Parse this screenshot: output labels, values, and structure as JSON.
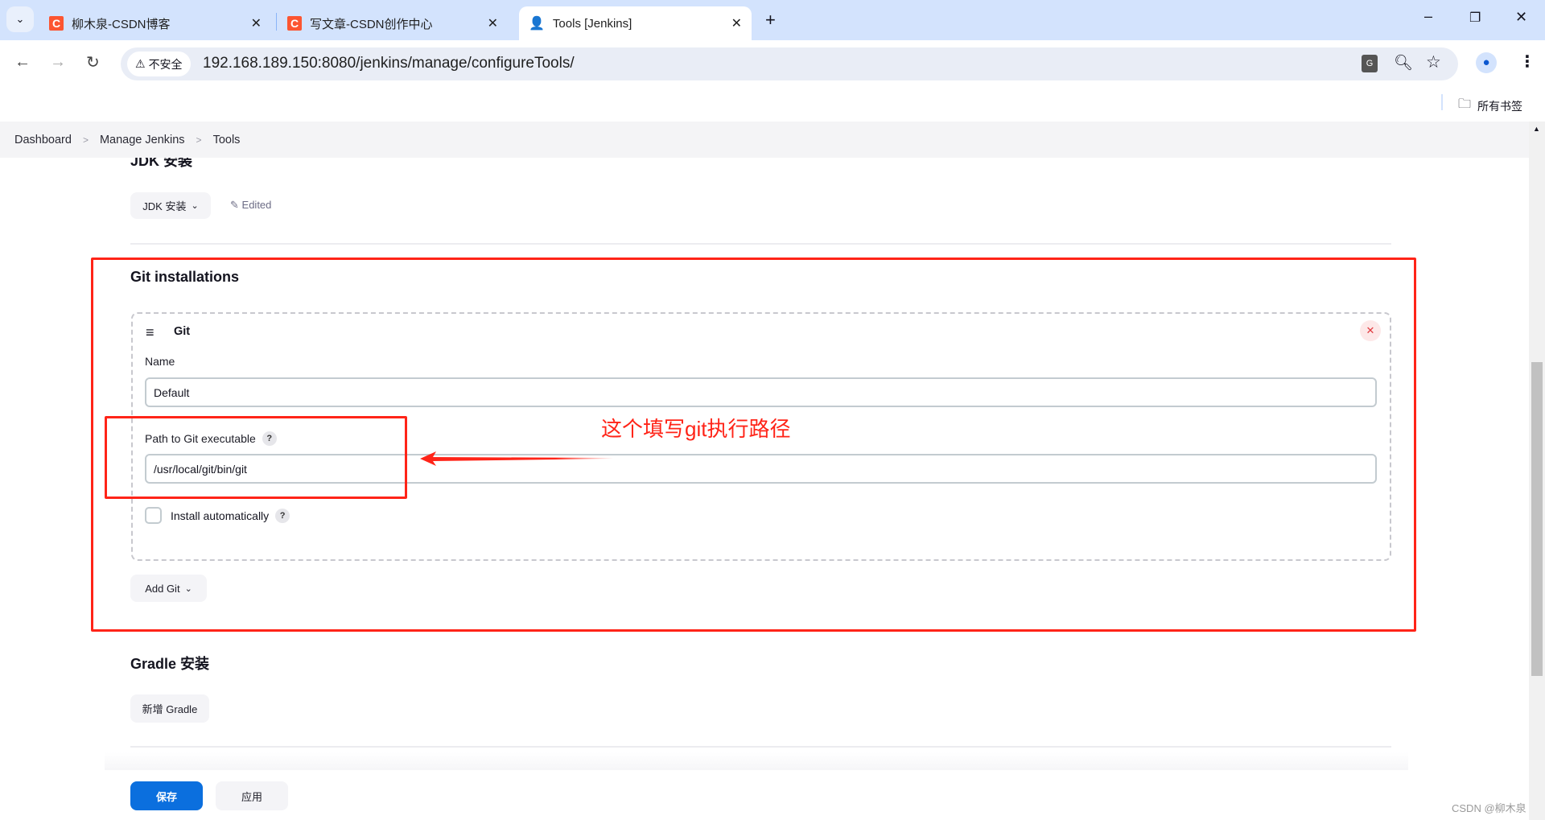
{
  "browser": {
    "tabs": [
      {
        "title": "柳木泉-CSDN博客",
        "icon": "csdn-icon"
      },
      {
        "title": "写文章-CSDN创作中心",
        "icon": "csdn-icon"
      },
      {
        "title": "Tools [Jenkins]",
        "icon": "jenkins-icon",
        "active": true
      }
    ],
    "security_label": "不安全",
    "url": "192.168.189.150:8080/jenkins/manage/configureTools/",
    "bookmarks_label": "所有书签"
  },
  "breadcrumb": [
    "Dashboard",
    "Manage Jenkins",
    "Tools"
  ],
  "jdk": {
    "heading": "JDK 安装",
    "button": "JDK 安装",
    "edited": "Edited"
  },
  "git": {
    "heading": "Git installations",
    "card_title": "Git",
    "name_label": "Name",
    "name_value": "Default",
    "path_label": "Path to Git executable",
    "path_value": "/usr/local/git/bin/git",
    "install_label": "Install automatically",
    "install_checked": false,
    "add_button": "Add Git"
  },
  "annotation": "这个填写git执行路径",
  "gradle": {
    "heading": "Gradle 安装",
    "button": "新增 Gradle"
  },
  "footer": {
    "save": "保存",
    "apply": "应用"
  },
  "watermark": "CSDN @柳木泉",
  "colors": {
    "annotation": "#ff2418",
    "primary": "#0b6fde"
  }
}
